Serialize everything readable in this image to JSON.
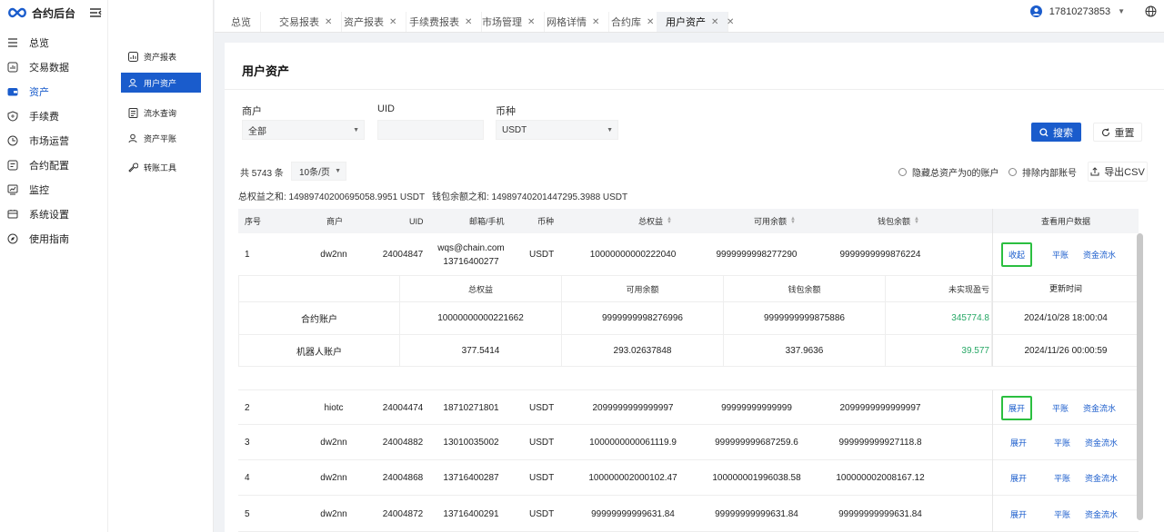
{
  "brand": "合约后台",
  "nav": [
    {
      "label": "总览",
      "icon": "menu-icon"
    },
    {
      "label": "交易数据",
      "icon": "chart-icon"
    },
    {
      "label": "资产",
      "icon": "wallet-icon",
      "active": true
    },
    {
      "label": "手续费",
      "icon": "shield-icon"
    },
    {
      "label": "市场运营",
      "icon": "clock-icon"
    },
    {
      "label": "合约配置",
      "icon": "doc-icon"
    },
    {
      "label": "监控",
      "icon": "monitor-icon"
    },
    {
      "label": "系统设置",
      "icon": "settings-icon"
    },
    {
      "label": "使用指南",
      "icon": "compass-icon"
    }
  ],
  "subnav": [
    {
      "label": "资产报表"
    },
    {
      "label": "用户资产",
      "active": true
    },
    {
      "label": "流水查询"
    },
    {
      "label": "资产平账"
    },
    {
      "label": "转账工具"
    }
  ],
  "tabs": [
    {
      "label": "总览",
      "closable": false
    },
    {
      "label": "交易报表",
      "closable": true
    },
    {
      "label": "资产报表",
      "closable": true
    },
    {
      "label": "手续费报表",
      "closable": true
    },
    {
      "label": "市场管理",
      "closable": true
    },
    {
      "label": "网格详情",
      "closable": true
    },
    {
      "label": "合约库",
      "closable": true
    },
    {
      "label": "用户资产",
      "closable": true,
      "active": true
    }
  ],
  "user": {
    "phone": "17810273853"
  },
  "page": {
    "title": "用户资产"
  },
  "filters": {
    "merchant_label": "商户",
    "merchant_value": "全部",
    "uid_label": "UID",
    "uid_value": "",
    "coin_label": "币种",
    "coin_value": "USDT",
    "search": "搜索",
    "reset": "重置"
  },
  "summary": {
    "total": "共 5743 条",
    "page_size": "10条/页",
    "hide_zero": "隐藏总资产为0的账户",
    "exclude_internal": "排除内部账号",
    "export": "导出CSV",
    "equity_sum": "总权益之和:  14989740200695058.9951 USDT",
    "wallet_sum": "钱包余额之和:  14989740201447295.3988 USDT"
  },
  "table": {
    "headers": [
      "序号",
      "商户",
      "UID",
      "邮箱/手机",
      "币种",
      "总权益",
      "可用余额",
      "钱包余额",
      "查看用户数据"
    ],
    "rows": [
      {
        "no": "1",
        "merchant": "dw2nn",
        "uid": "24004847",
        "contact": "wqs@chain.com",
        "contact2": "13716400277",
        "coin": "USDT",
        "equity": "10000000000222040",
        "available": "9999999998277290",
        "wallet": "9999999999876224",
        "toggle": "收起",
        "highlight": true
      },
      {
        "no": "2",
        "merchant": "hiotc",
        "uid": "24004474",
        "contact": "18710271801",
        "contact2": "",
        "coin": "USDT",
        "equity": "2099999999999997",
        "available": "99999999999999",
        "wallet": "2099999999999997",
        "toggle": "展开",
        "highlight": true
      },
      {
        "no": "3",
        "merchant": "dw2nn",
        "uid": "24004882",
        "contact": "13010035002",
        "contact2": "",
        "coin": "USDT",
        "equity": "1000000000061119.9",
        "available": "999999999687259.6",
        "wallet": "999999999927118.8",
        "toggle": "展开",
        "highlight": false
      },
      {
        "no": "4",
        "merchant": "dw2nn",
        "uid": "24004868",
        "contact": "13716400287",
        "contact2": "",
        "coin": "USDT",
        "equity": "100000002000102.47",
        "available": "100000001996038.58",
        "wallet": "100000002008167.12",
        "toggle": "展开",
        "highlight": false
      },
      {
        "no": "5",
        "merchant": "dw2nn",
        "uid": "24004872",
        "contact": "13716400291",
        "contact2": "",
        "coin": "USDT",
        "equity": "99999999999631.84",
        "available": "99999999999631.84",
        "wallet": "99999999999631.84",
        "toggle": "展开",
        "highlight": false
      }
    ],
    "action_flat": "平账",
    "action_flow": "资金流水"
  },
  "detail": {
    "headers": [
      "总权益",
      "可用余额",
      "钱包余额",
      "未实现盈亏",
      "更新时间"
    ],
    "rows": [
      {
        "name": "合约账户",
        "equity": "10000000000221662",
        "available": "9999999998276996",
        "wallet": "9999999999875886",
        "pnl": "345774.8",
        "time": "2024/10/28 18:00:04"
      },
      {
        "name": "机器人账户",
        "equity": "377.5414",
        "available": "293.02637848",
        "wallet": "337.9636",
        "pnl": "39.577",
        "time": "2024/11/26 00:00:59"
      }
    ]
  },
  "colors": {
    "primary": "#1a5ccc",
    "highlight": "#2bbf40",
    "profit": "#27a866"
  }
}
